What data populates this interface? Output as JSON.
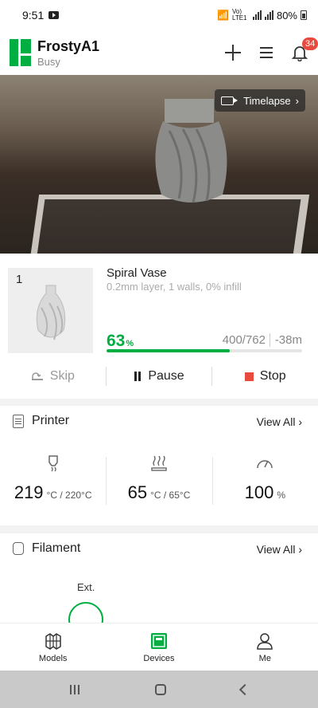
{
  "status_bar": {
    "time": "9:51",
    "network": "Vo) LTE1",
    "battery": "80%"
  },
  "header": {
    "printer_name": "FrostyA1",
    "state": "Busy",
    "notification_count": "34"
  },
  "camera": {
    "timelapse_label": "Timelapse"
  },
  "job": {
    "plate_number": "1",
    "name": "Spiral Vase",
    "details": "0.2mm layer, 1 walls, 0% infill",
    "progress_percent": "63",
    "progress_fraction": 0.63,
    "layers": "400/762",
    "remaining": "-38m",
    "skip_label": "Skip",
    "pause_label": "Pause",
    "stop_label": "Stop"
  },
  "printer": {
    "title": "Printer",
    "view_all": "View All",
    "nozzle": {
      "value": "219",
      "unit": "°C / 220°C"
    },
    "bed": {
      "value": "65",
      "unit": "°C / 65°C"
    },
    "speed": {
      "value": "100",
      "unit": "%"
    }
  },
  "filament": {
    "title": "Filament",
    "view_all": "View All",
    "ext_label": "Ext."
  },
  "nav": {
    "models": "Models",
    "devices": "Devices",
    "me": "Me"
  },
  "colors": {
    "accent": "#00ae42",
    "stop": "#e84a3d",
    "badge": "#e84a3d"
  }
}
